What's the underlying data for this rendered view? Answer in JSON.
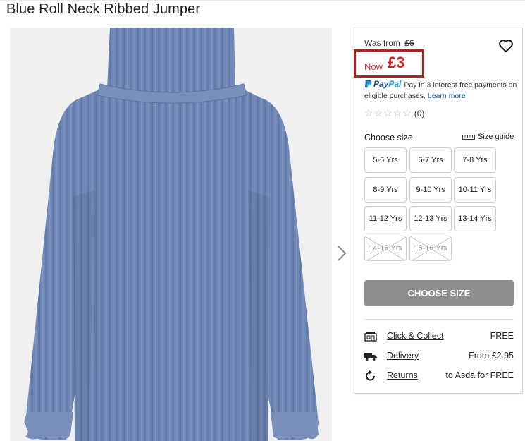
{
  "product": {
    "title": "Blue Roll Neck Ribbed Jumper"
  },
  "pricing": {
    "was_label": "Was from",
    "was_price": "£6",
    "now_label": "Now",
    "now_price": "£3"
  },
  "paypal": {
    "brand_pay": "Pay",
    "brand_pal": "Pal",
    "message": "Pay in 3 interest-free payments on eligible purchases.",
    "learn_more": "Learn more"
  },
  "rating": {
    "stars": "☆☆☆☆☆",
    "count": "(0)"
  },
  "size_selector": {
    "label": "Choose size",
    "size_guide": "Size guide",
    "sizes": [
      {
        "label": "5-6 Yrs",
        "available": true
      },
      {
        "label": "6-7 Yrs",
        "available": true
      },
      {
        "label": "7-8 Yrs",
        "available": true
      },
      {
        "label": "8-9 Yrs",
        "available": true
      },
      {
        "label": "9-10 Yrs",
        "available": true
      },
      {
        "label": "10-11 Yrs",
        "available": true
      },
      {
        "label": "11-12 Yrs",
        "available": true
      },
      {
        "label": "12-13 Yrs",
        "available": true
      },
      {
        "label": "13-14 Yrs",
        "available": true
      },
      {
        "label": "14-15 Yrs",
        "available": false
      },
      {
        "label": "15-16 Yrs",
        "available": false
      }
    ]
  },
  "cta": {
    "label": "CHOOSE SIZE"
  },
  "services": [
    {
      "icon": "store-icon",
      "link": "Click & Collect",
      "value": "FREE"
    },
    {
      "icon": "delivery-truck-icon",
      "link": "Delivery",
      "value": "From £2.95"
    },
    {
      "icon": "returns-icon",
      "link": "Returns",
      "value": "to Asda for FREE"
    }
  ],
  "colors": {
    "price_red": "#d3232b",
    "highlight_border": "#b21f1f",
    "cta_grey": "#8e8e8e",
    "jumper_blue": "#6f88b5"
  }
}
